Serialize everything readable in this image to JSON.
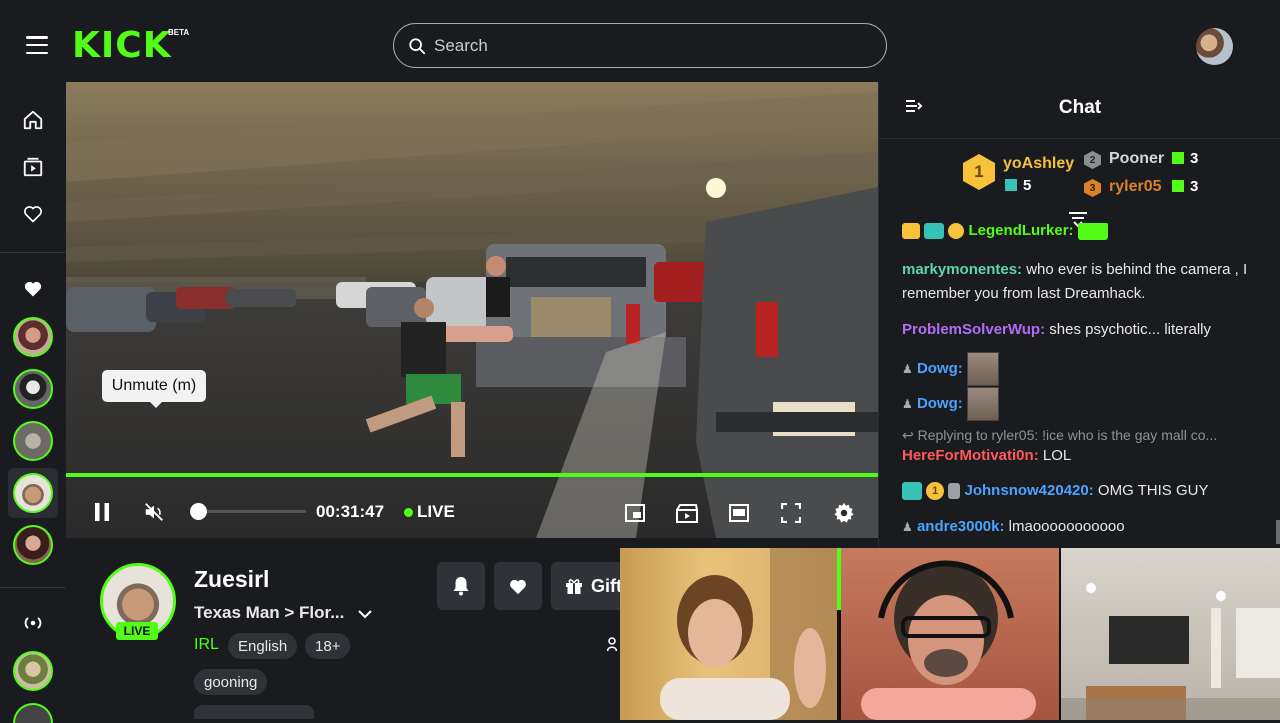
{
  "header": {
    "logo": "KICK",
    "logo_badge": "BETA",
    "search_placeholder": "Search"
  },
  "sidebar": {
    "nav": [
      "home-icon",
      "browse-icon",
      "following-icon"
    ],
    "live_icon": "broadcast-icon"
  },
  "player": {
    "tooltip": "Unmute (m)",
    "time": "00:31:47",
    "live_label": "LIVE",
    "colors": {
      "accent": "#53fc18"
    }
  },
  "chat": {
    "title": "Chat",
    "leaderboard": {
      "first": {
        "rank": "1",
        "name": "yoAshley",
        "gifts": "5"
      },
      "second": {
        "rank": "2",
        "name": "Pooner",
        "gifts": "3"
      },
      "third": {
        "rank": "3",
        "name": "ryler05",
        "gifts": "3"
      }
    },
    "messages": [
      {
        "user": "LegendLurker:",
        "text": "",
        "color": "#53fc18"
      },
      {
        "user": "markymonentes:",
        "text": "who ever is behind the camera , I remember you from last Dreamhack.",
        "color": "#5dd6a8"
      },
      {
        "user": "ProblemSolverWup:",
        "text": "shes psychotic... literally",
        "color": "#b46cf5"
      },
      {
        "user": "Dowg:",
        "text": "",
        "color": "#4aa3ff"
      },
      {
        "user": "Dowg:",
        "text": "",
        "color": "#4aa3ff"
      },
      {
        "reply": "Replying to ryler05: !ice who is the gay mall co...",
        "user": "HereForMotivati0n:",
        "text": "LOL",
        "color": "#ff5a5a"
      },
      {
        "user": "Johnsnow420420:",
        "text": "OMG THIS GUY",
        "color": "#4aa3ff",
        "badge": "1"
      },
      {
        "user": "andre3000k:",
        "text": "lmaooooooooooo",
        "color": "#4aa3ff"
      }
    ]
  },
  "channel": {
    "name": "Zuesirl",
    "title": "Texas Man > Flor...",
    "live_badge": "LIVE",
    "category": "IRL",
    "tags": [
      "English",
      "18+",
      "gooning"
    ],
    "gift_label": "Gift"
  }
}
